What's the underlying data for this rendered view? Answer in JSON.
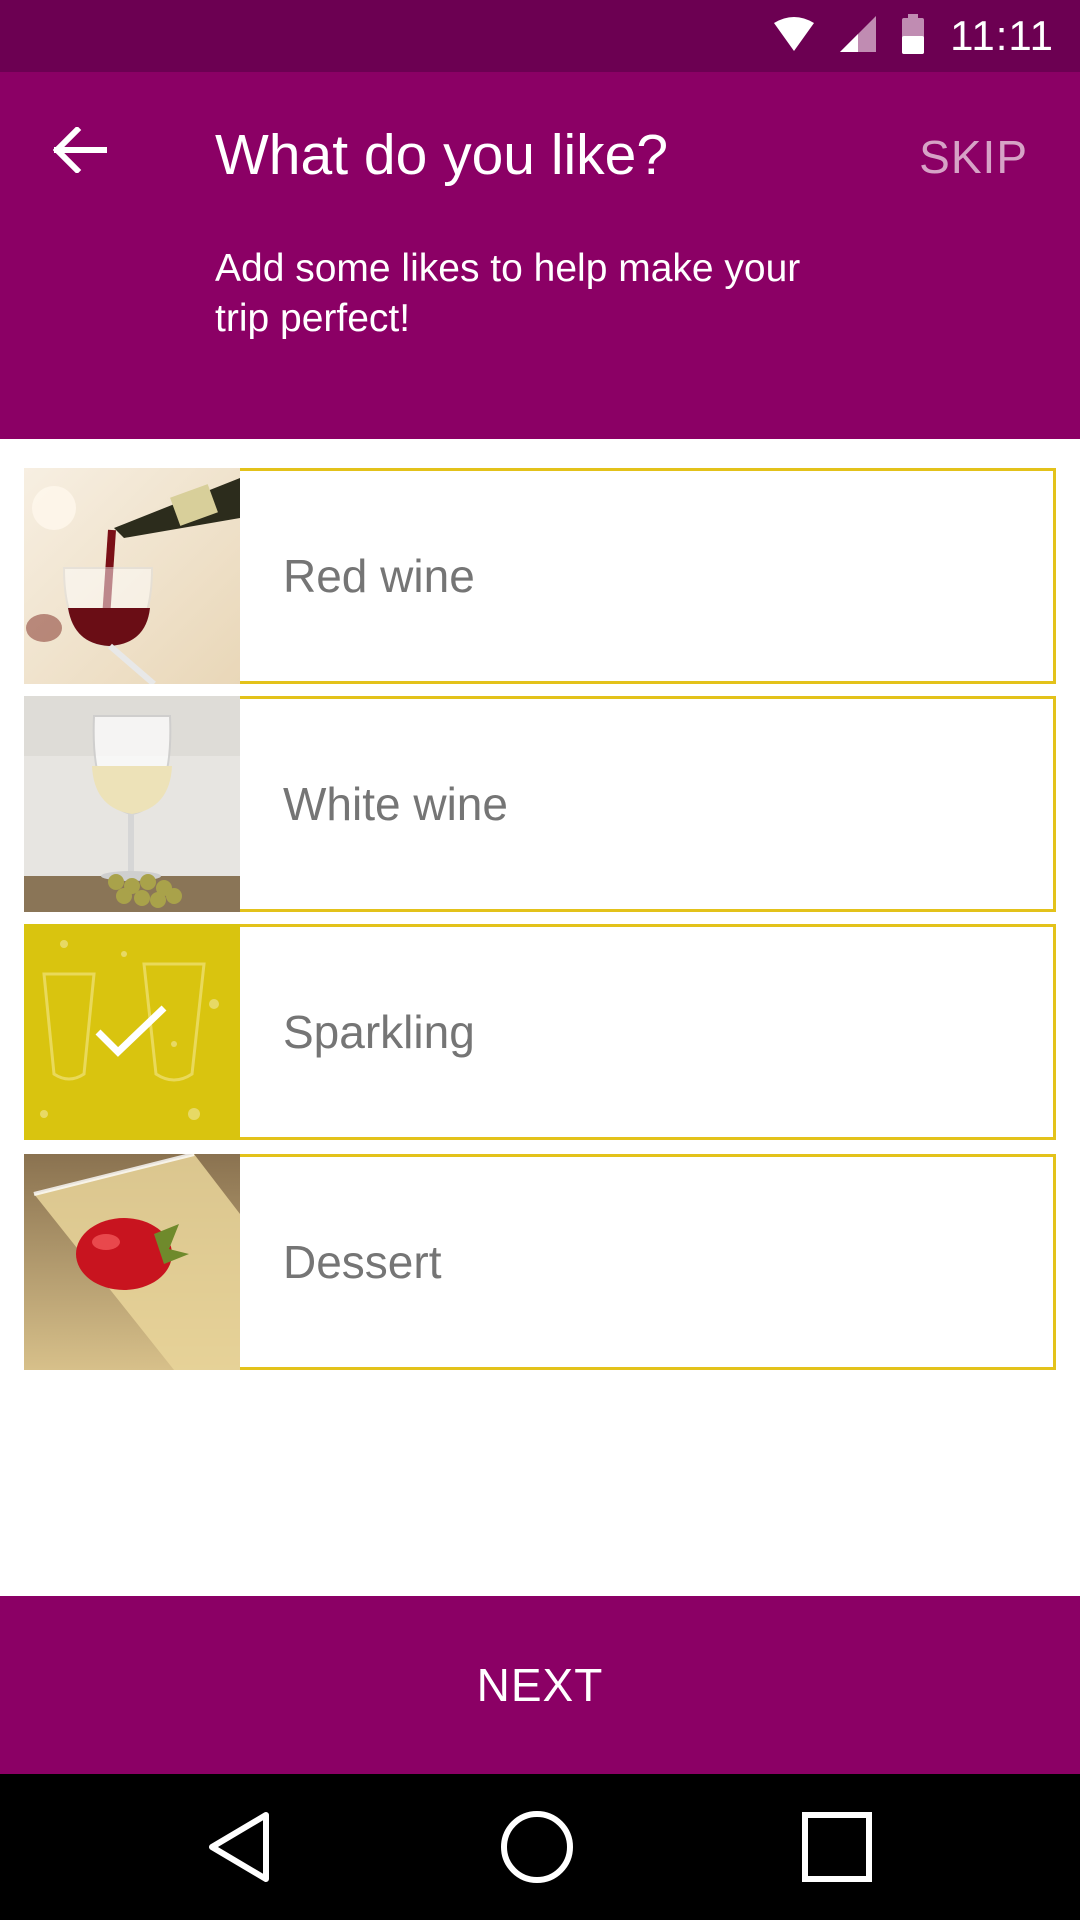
{
  "status_bar": {
    "time": "11:11",
    "icons": [
      "wifi-icon",
      "cell-signal-icon",
      "battery-icon"
    ]
  },
  "header": {
    "title": "What do you like?",
    "skip_label": "SKIP",
    "subtitle": "Add some likes to help make your trip perfect!",
    "back_icon": "arrow-back-icon"
  },
  "likes": [
    {
      "label": "Red wine",
      "selected": false,
      "image": "red-wine-pour-photo"
    },
    {
      "label": "White wine",
      "selected": false,
      "image": "white-wine-glass-photo"
    },
    {
      "label": "Sparkling",
      "selected": true,
      "image": "sparkling-glasses-photo"
    },
    {
      "label": "Dessert",
      "selected": false,
      "image": "strawberry-champagne-photo"
    }
  ],
  "footer": {
    "next_label": "NEXT"
  },
  "nav": {
    "icons": [
      "back-triangle-icon",
      "home-circle-icon",
      "recents-square-icon"
    ]
  },
  "colors": {
    "status_bar": "#6c0052",
    "header": "#8b0065",
    "item_border": "#e3c21a",
    "selected_overlay": "#d9c40f",
    "label_text": "#757575"
  }
}
